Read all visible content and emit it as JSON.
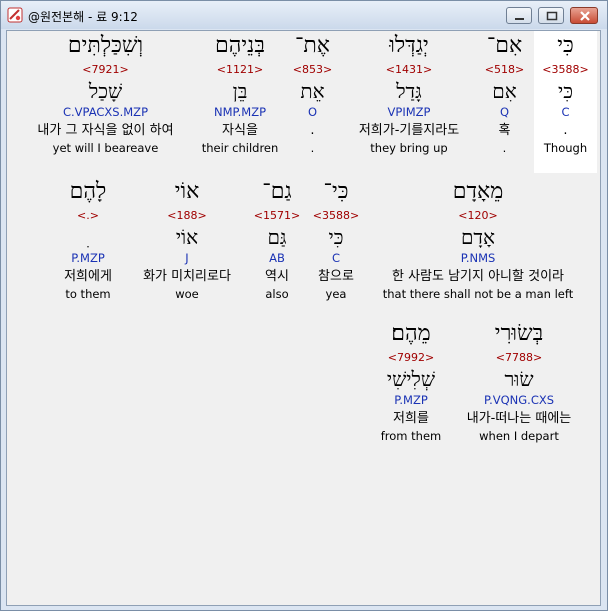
{
  "window": {
    "title": "@원전본해 - 료 9:12"
  },
  "rows": [
    [
      {
        "heb": "כִּי",
        "num": "<3588>",
        "lemma": "כִּי",
        "parse": "C",
        "ko": ".",
        "en": "Though"
      },
      {
        "heb": "אִם־",
        "num": "<518>",
        "lemma": "אִם",
        "parse": "Q",
        "ko": "혹",
        "en": "."
      },
      {
        "heb": "יְגַדְּלוּ",
        "num": "<1431>",
        "lemma": "גָּדַל",
        "parse": "VPIMZP",
        "ko": "저희가-기를지라도",
        "en": "they bring up"
      },
      {
        "heb": "אֶת־",
        "num": "<853>",
        "lemma": "אֵת",
        "parse": "O",
        "ko": ".",
        "en": "."
      },
      {
        "heb": "בְּנֵיהֶם",
        "num": "<1121>",
        "lemma": "בֵּן",
        "parse": "NMP.MZP",
        "ko": "자식을",
        "en": "their children"
      },
      {
        "heb": "וְשִׁכַּלְתִּים",
        "num": "<7921>",
        "lemma": "שָׁכַל",
        "parse": "C.VPACXS.MZP",
        "ko": "내가 그 자식을 없이 하여",
        "en": "yet will I beareave"
      }
    ],
    [
      {
        "heb": "מֵאָדָם",
        "num": "<120>",
        "lemma": "אָדָם",
        "parse": "P.NMS",
        "ko": "한 사람도 남기지 아니할 것이라",
        "en": "that there shall not be a man left"
      },
      {
        "heb": "כִּי־",
        "num": "<3588>",
        "lemma": "כִּי",
        "parse": "C",
        "ko": "참으로",
        "en": "yea"
      },
      {
        "heb": "גַם־",
        "num": "<1571>",
        "lemma": "גַּם",
        "parse": "AB",
        "ko": "역시",
        "en": "also"
      },
      {
        "heb": "אוֹי",
        "num": "<188>",
        "lemma": "אוֹי",
        "parse": "J",
        "ko": "화가 미치리로다",
        "en": "woe"
      },
      {
        "heb": "לָהֶם",
        "num": "<.>",
        "lemma": "ִ",
        "parse": "P.MZP",
        "ko": "저희에게",
        "en": "to them"
      }
    ],
    [
      {
        "heb": "בְּשׂוּרִי",
        "num": "<7788>",
        "lemma": "שׂוּר",
        "parse": "P.VQNG.CXS",
        "ko": "내가-떠나는 때에는",
        "en": "when I depart"
      },
      {
        "heb": "מֵהֶם׃",
        "num": "<7992>",
        "lemma": "שְׁלִישִׁי",
        "parse": "P.MZP",
        "ko": "저희를",
        "en": "from them"
      }
    ]
  ]
}
